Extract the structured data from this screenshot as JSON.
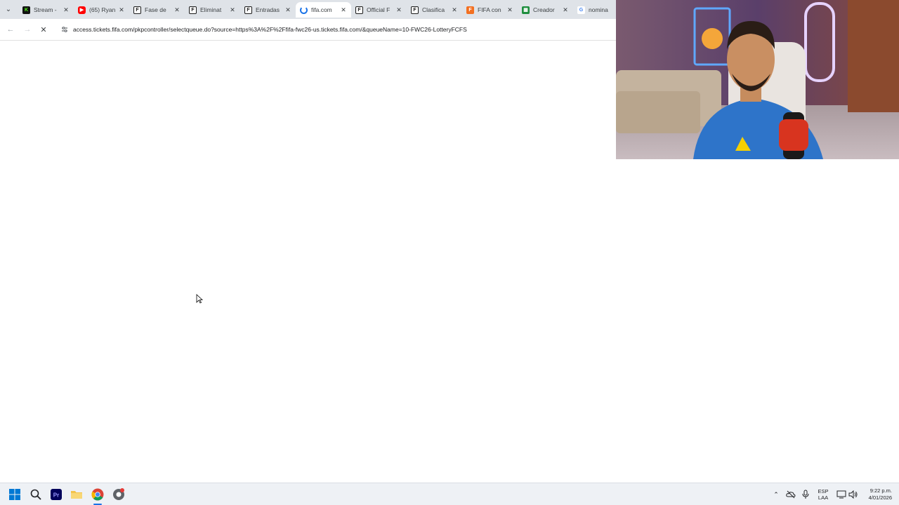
{
  "browser": {
    "tabs": [
      {
        "title": "Stream -",
        "icon": "kick-icon"
      },
      {
        "title": "(65) Ryan",
        "icon": "youtube-icon"
      },
      {
        "title": "Fase de",
        "icon": "fifa-f-icon"
      },
      {
        "title": "Eliminat",
        "icon": "fifa-f-icon"
      },
      {
        "title": "Entradas",
        "icon": "fifa-f-icon"
      },
      {
        "title": "fifa.com",
        "icon": "loading-spinner-icon",
        "active": true
      },
      {
        "title": "Official F",
        "icon": "fifa-f-icon"
      },
      {
        "title": "Clasifica",
        "icon": "fifa-f-icon"
      },
      {
        "title": "FIFA con",
        "icon": "fifa-orange-icon"
      },
      {
        "title": "Creador",
        "icon": "sheets-icon"
      },
      {
        "title": "nomina",
        "icon": "google-icon"
      }
    ],
    "address_bar": {
      "url": "access.tickets.fifa.com/pkpcontroller/selectqueue.do?source=https%3A%2F%2Ffifa-fwc26-us.tickets.fifa.com/&queueName=10-FWC26-LotteryFCFS"
    }
  },
  "taskbar": {
    "apps": [
      "windows-start-icon",
      "search-icon",
      "premiere-pro-icon",
      "file-explorer-icon",
      "chrome-icon",
      "chrome-dev-icon"
    ],
    "language": {
      "line1": "ESP",
      "line2": "LAA"
    },
    "clock": {
      "time": "9:22 p.m.",
      "date": "4/01/2026"
    }
  },
  "colors": {
    "tabstrip": "#dfe3e8",
    "taskbar": "#eef1f5",
    "accent": "#1a73e8"
  }
}
